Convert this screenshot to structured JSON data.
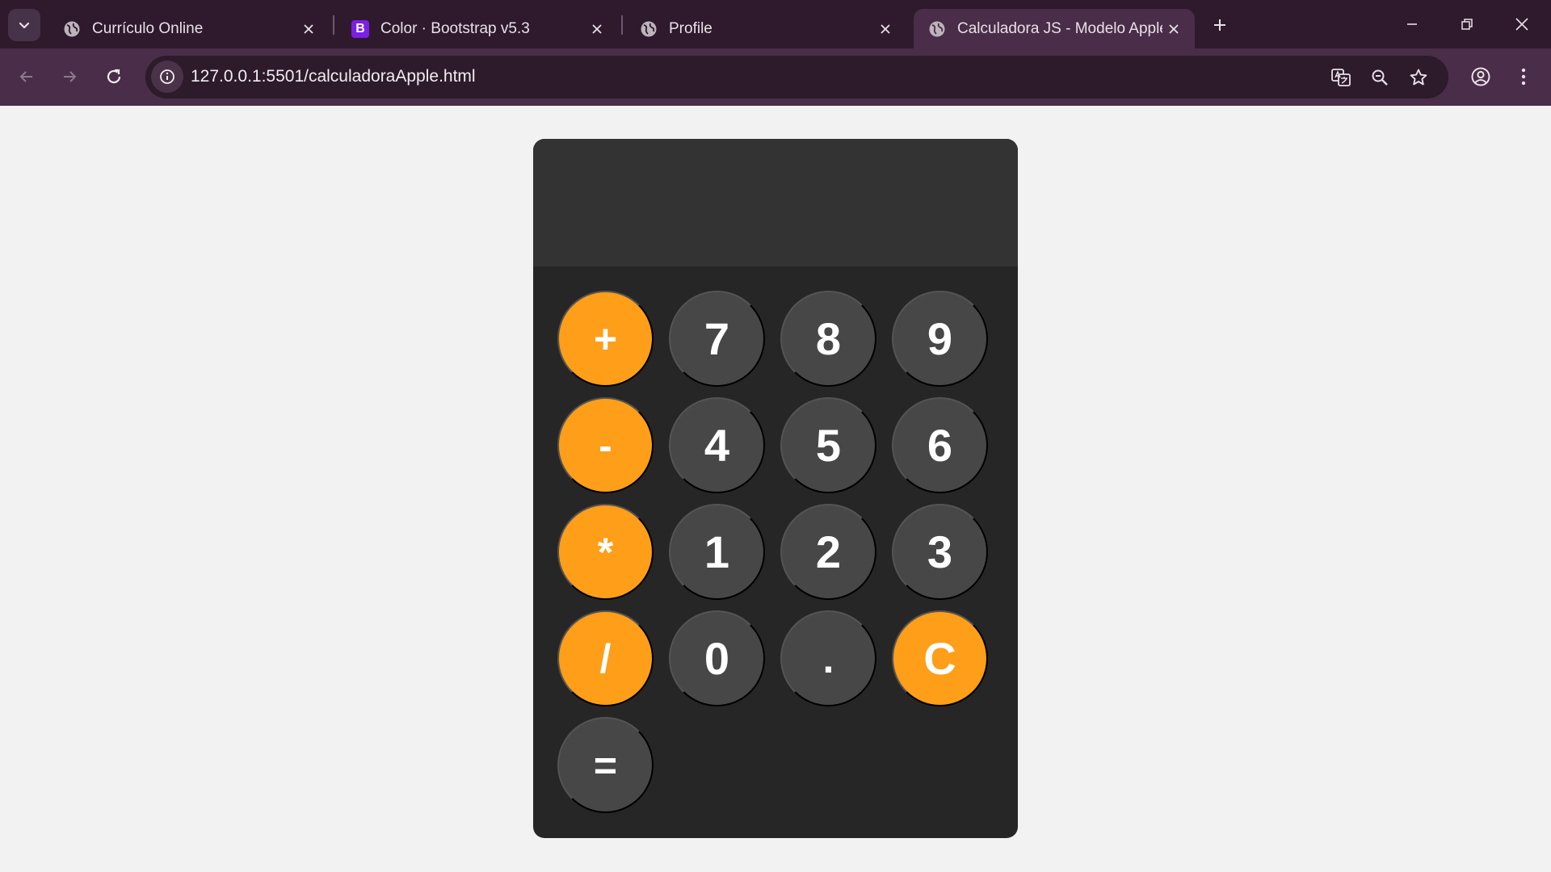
{
  "browser": {
    "tabs": [
      {
        "title": "Currículo Online",
        "icon": "globe-icon"
      },
      {
        "title": "Color · Bootstrap v5.3",
        "icon": "bootstrap-icon"
      },
      {
        "title": "Profile",
        "icon": "globe-icon"
      },
      {
        "title": "Calculadora JS - Modelo Apple",
        "icon": "globe-icon",
        "active": true
      }
    ],
    "bootstrap_favicon_letter": "B",
    "url": "127.0.0.1:5501/calculadoraApple.html",
    "colors": {
      "tabbar": "#2e1a2c",
      "toolbar": "#4a2d48",
      "omnibox": "#2d1a2b"
    }
  },
  "calculator": {
    "display": "",
    "keys": [
      {
        "label": "+",
        "kind": "operator"
      },
      {
        "label": "7",
        "kind": "digit"
      },
      {
        "label": "8",
        "kind": "digit"
      },
      {
        "label": "9",
        "kind": "digit"
      },
      {
        "label": "-",
        "kind": "operator"
      },
      {
        "label": "4",
        "kind": "digit"
      },
      {
        "label": "5",
        "kind": "digit"
      },
      {
        "label": "6",
        "kind": "digit"
      },
      {
        "label": "*",
        "kind": "operator"
      },
      {
        "label": "1",
        "kind": "digit"
      },
      {
        "label": "2",
        "kind": "digit"
      },
      {
        "label": "3",
        "kind": "digit"
      },
      {
        "label": "/",
        "kind": "operator"
      },
      {
        "label": "0",
        "kind": "digit"
      },
      {
        "label": ".",
        "kind": "digit"
      },
      {
        "label": "C",
        "kind": "operator"
      },
      {
        "label": "=",
        "kind": "digit"
      }
    ],
    "colors": {
      "operator": "#fe9e19",
      "digit": "#474747",
      "body": "#262626",
      "display": "#333333"
    }
  }
}
